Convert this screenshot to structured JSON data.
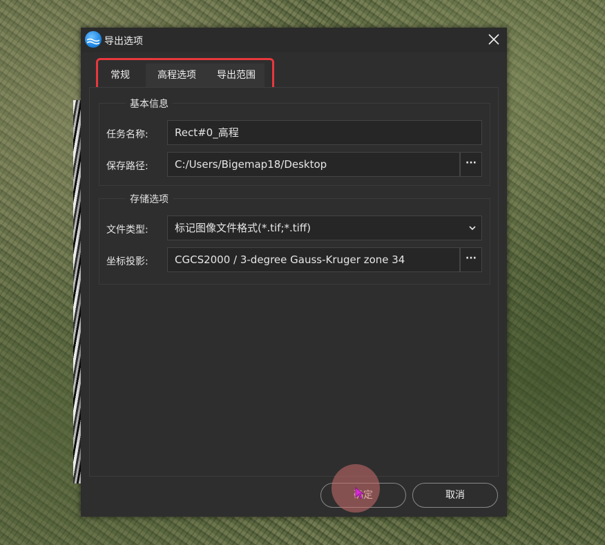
{
  "window": {
    "title": "导出选项",
    "icons": {
      "app": "app-logo-icon",
      "close": "close-icon"
    }
  },
  "tabs": [
    {
      "label": "常规",
      "active": true
    },
    {
      "label": "高程选项",
      "active": false
    },
    {
      "label": "导出范围",
      "active": false
    }
  ],
  "basic_info": {
    "title": "基本信息",
    "task_name": {
      "label": "任务名称:",
      "value": "Rect#0_高程"
    },
    "save_path": {
      "label": "保存路径:",
      "value": "C:/Users/Bigemap18/Desktop",
      "browse": "···"
    }
  },
  "storage": {
    "title": "存储选项",
    "file_type": {
      "label": "文件类型:",
      "value": "标记图像文件格式(*.tif;*.tiff)",
      "icon": "chevron-down-icon"
    },
    "projection": {
      "label": "坐标投影:",
      "value": "CGCS2000 / 3-degree Gauss-Kruger zone 34",
      "browse": "···"
    }
  },
  "footer": {
    "ok": "确定",
    "cancel": "取消"
  },
  "colors": {
    "highlight": "#e8383d",
    "dialog_bg": "#2e2e2e",
    "click_ripple": "#cd6e6e"
  }
}
